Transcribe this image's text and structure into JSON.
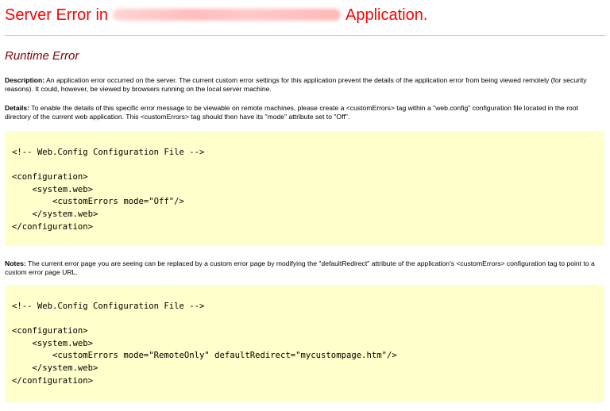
{
  "header": {
    "title_prefix": "Server Error in",
    "title_suffix": "Application."
  },
  "error": {
    "heading": "Runtime Error",
    "description_label": "Description:",
    "description_text": " An application error occurred on the server. The current custom error settings for this application prevent the details of the application error from being viewed remotely (for security reasons). It could, however, be viewed by browsers running on the local server machine.",
    "details_label": "Details:",
    "details_text": " To enable the details of this specific error message to be viewable on remote machines, please create a <customErrors> tag within a \"web.config\" configuration file located in the root directory of the current web application. This <customErrors> tag should then have its \"mode\" attribute set to \"Off\".",
    "notes_label": "Notes:",
    "notes_text": " The current error page you are seeing can be replaced by a custom error page by modifying the \"defaultRedirect\" attribute of the application's <customErrors> configuration tag to point to a custom error page URL."
  },
  "code_blocks": [
    {
      "code": "<!-- Web.Config Configuration File -->\n\n<configuration>\n    <system.web>\n        <customErrors mode=\"Off\"/>\n    </system.web>\n</configuration>"
    },
    {
      "code": "<!-- Web.Config Configuration File -->\n\n<configuration>\n    <system.web>\n        <customErrors mode=\"RemoteOnly\" defaultRedirect=\"mycustompage.htm\"/>\n    </system.web>\n</configuration>"
    }
  ],
  "colors": {
    "title": "#ff0000",
    "heading": "#800000",
    "code_background": "#ffffcc",
    "rule": "#c0c0c0"
  }
}
